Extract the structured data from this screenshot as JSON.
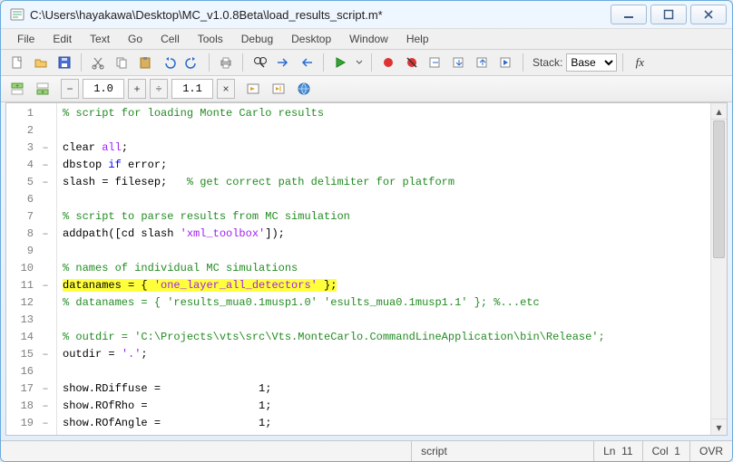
{
  "window": {
    "title": "C:\\Users\\hayakawa\\Desktop\\MC_v1.0.8Beta\\load_results_script.m*"
  },
  "menu": {
    "items": [
      "File",
      "Edit",
      "Text",
      "Go",
      "Cell",
      "Tools",
      "Debug",
      "Desktop",
      "Window",
      "Help"
    ]
  },
  "toolbar": {
    "stack_label": "Stack:",
    "stack_value": "Base",
    "fx_label": "fx"
  },
  "celltoolbar": {
    "spinA": "1.0",
    "spinB": "1.1"
  },
  "status": {
    "mode": "script",
    "ln_label": "Ln",
    "ln": "11",
    "col_label": "Col",
    "col": "1",
    "ovr": "OVR"
  },
  "gutter": {
    "dash_marker": "–"
  },
  "lines": [
    {
      "n": "1",
      "dash": false,
      "segs": [
        {
          "t": "% script for loading Monte Carlo results",
          "c": "cm"
        }
      ]
    },
    {
      "n": "2",
      "dash": false,
      "segs": []
    },
    {
      "n": "3",
      "dash": true,
      "segs": [
        {
          "t": "clear "
        },
        {
          "t": "all",
          "c": "st"
        },
        {
          "t": ";"
        }
      ]
    },
    {
      "n": "4",
      "dash": true,
      "segs": [
        {
          "t": "dbstop "
        },
        {
          "t": "if",
          "c": "kw"
        },
        {
          "t": " error;"
        }
      ]
    },
    {
      "n": "5",
      "dash": true,
      "segs": [
        {
          "t": "slash = filesep;   "
        },
        {
          "t": "% get correct path delimiter for platform",
          "c": "cm"
        }
      ]
    },
    {
      "n": "6",
      "dash": false,
      "segs": []
    },
    {
      "n": "7",
      "dash": false,
      "segs": [
        {
          "t": "% script to parse results from MC simulation",
          "c": "cm"
        }
      ]
    },
    {
      "n": "8",
      "dash": true,
      "segs": [
        {
          "t": "addpath([cd slash "
        },
        {
          "t": "'xml_toolbox'",
          "c": "st"
        },
        {
          "t": "]);"
        }
      ]
    },
    {
      "n": "9",
      "dash": false,
      "segs": []
    },
    {
      "n": "10",
      "dash": false,
      "segs": [
        {
          "t": "% names of individual MC simulations",
          "c": "cm"
        }
      ]
    },
    {
      "n": "11",
      "dash": true,
      "hl": true,
      "segs": [
        {
          "t": "datanames = { "
        },
        {
          "t": "'one_layer_all_detectors'",
          "c": "st"
        },
        {
          "t": " };"
        }
      ]
    },
    {
      "n": "12",
      "dash": false,
      "segs": [
        {
          "t": "% datanames = { 'results_mua0.1musp1.0' 'esults_mua0.1musp1.1' }; %...etc",
          "c": "cm"
        }
      ]
    },
    {
      "n": "13",
      "dash": false,
      "segs": []
    },
    {
      "n": "14",
      "dash": false,
      "segs": [
        {
          "t": "% outdir = 'C:\\Projects\\vts\\src\\Vts.MonteCarlo.CommandLineApplication\\bin\\Release';",
          "c": "cm"
        }
      ]
    },
    {
      "n": "15",
      "dash": true,
      "segs": [
        {
          "t": "outdir = "
        },
        {
          "t": "'.'",
          "c": "st"
        },
        {
          "t": ";"
        }
      ]
    },
    {
      "n": "16",
      "dash": false,
      "segs": []
    },
    {
      "n": "17",
      "dash": true,
      "segs": [
        {
          "t": "show.RDiffuse =               1;"
        }
      ]
    },
    {
      "n": "18",
      "dash": true,
      "segs": [
        {
          "t": "show.ROfRho =                 1;"
        }
      ]
    },
    {
      "n": "19",
      "dash": true,
      "segs": [
        {
          "t": "show.ROfAngle =               1;"
        }
      ]
    }
  ]
}
